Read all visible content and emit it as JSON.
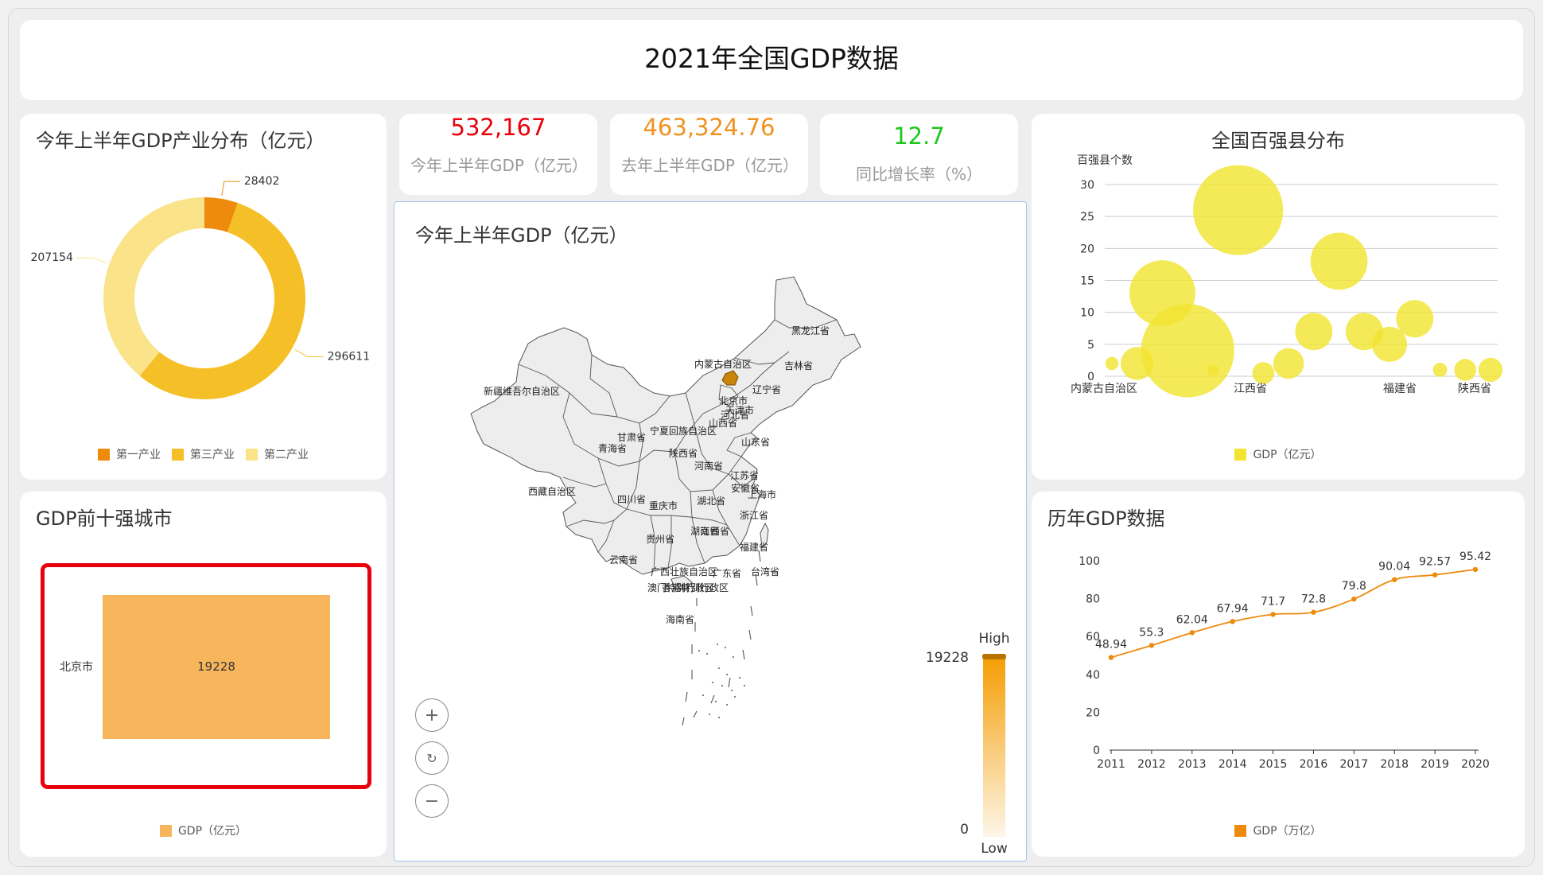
{
  "header": {
    "title": "2021年全国GDP数据"
  },
  "panels": {
    "donut_title": "今年上半年GDP产业分布（亿元）",
    "top10_title": "GDP前十强城市",
    "map_title": "今年上半年GDP（亿元）",
    "bubble_title": "全国百强县分布",
    "line_title": "历年GDP数据"
  },
  "kpis": [
    {
      "value": "532,167",
      "label": "今年上半年GDP（亿元）",
      "color": "#e8000b"
    },
    {
      "value": "463,324.76",
      "label": "去年上半年GDP（亿元）",
      "color": "#f0921e"
    },
    {
      "value": "12.7",
      "label": "同比增长率（%）",
      "color": "#1ec71e"
    }
  ],
  "map": {
    "visual_map": {
      "high_text": "High",
      "low_text": "Low",
      "max": "19228",
      "min": "0"
    },
    "province_labels": [
      "黑龙江省",
      "吉林省",
      "辽宁省",
      "内蒙古自治区",
      "新疆维吾尔自治区",
      "北京市",
      "天津市",
      "河北省",
      "山西省",
      "山东省",
      "宁夏回族自治区",
      "甘肃省",
      "青海省",
      "陕西省",
      "河南省",
      "江苏省",
      "安徽省",
      "上海市",
      "西藏自治区",
      "四川省",
      "湖北省",
      "重庆市",
      "浙江省",
      "江西省",
      "湖南省",
      "贵州省",
      "福建省",
      "云南省",
      "广西壮族自治区",
      "广东省",
      "台湾省",
      "香港特别行政区",
      "澳门特别行政区",
      "海南省"
    ],
    "zoom_in_icon": "plus-icon",
    "reset_icon": "refresh-icon",
    "zoom_out_icon": "minus-icon"
  },
  "chart_data": [
    {
      "type": "pie",
      "variant": "donut",
      "title": "今年上半年GDP产业分布（亿元）",
      "slices": [
        {
          "name": "第一产业",
          "value": 28402,
          "color": "#ee8a0c"
        },
        {
          "name": "第三产业",
          "value": 296611,
          "color": "#f5c027"
        },
        {
          "name": "第二产业",
          "value": 207154,
          "color": "#fae388"
        }
      ],
      "legend_position": "bottom"
    },
    {
      "type": "treemap",
      "title": "GDP前十强城市",
      "items": [
        {
          "name": "北京市",
          "value": 19228
        }
      ],
      "color": "#f7b55c",
      "legend": [
        "GDP（亿元）"
      ],
      "legend_position": "bottom"
    },
    {
      "type": "map",
      "title": "今年上半年GDP（亿元）",
      "regions": [
        {
          "name": "北京市",
          "value": 19228
        }
      ],
      "range": [
        0,
        19228
      ]
    },
    {
      "type": "scatter",
      "variant": "bubble",
      "title": "全国百强县分布",
      "ylabel": "百强县个数",
      "ylim": [
        0,
        30
      ],
      "yticks": [
        0,
        5,
        10,
        15,
        20,
        25,
        30
      ],
      "x_tick_labels": [
        "内蒙古自治区",
        "江西省",
        "福建省",
        "陕西省"
      ],
      "points": [
        {
          "x": 0.0,
          "y": 2,
          "size": 12
        },
        {
          "x": 1.0,
          "y": 2,
          "size": 30
        },
        {
          "x": 2.0,
          "y": 13,
          "size": 60
        },
        {
          "x": 3.0,
          "y": 4,
          "size": 85
        },
        {
          "x": 4.0,
          "y": 1,
          "size": 10
        },
        {
          "x": 5.0,
          "y": 26,
          "size": 82
        },
        {
          "x": 6.0,
          "y": 0.5,
          "size": 20
        },
        {
          "x": 7.0,
          "y": 2,
          "size": 28
        },
        {
          "x": 8.0,
          "y": 7,
          "size": 34
        },
        {
          "x": 9.0,
          "y": 18,
          "size": 52
        },
        {
          "x": 10.0,
          "y": 7,
          "size": 34
        },
        {
          "x": 11.0,
          "y": 5,
          "size": 32
        },
        {
          "x": 12.0,
          "y": 9,
          "size": 34
        },
        {
          "x": 13.0,
          "y": 1,
          "size": 13
        },
        {
          "x": 14.0,
          "y": 1,
          "size": 20
        },
        {
          "x": 15.0,
          "y": 1,
          "size": 22
        }
      ],
      "color": "#f2e431",
      "legend": [
        "GDP（亿元）"
      ],
      "legend_position": "bottom",
      "grid": true
    },
    {
      "type": "line",
      "title": "历年GDP数据",
      "x": [
        "2011",
        "2012",
        "2013",
        "2014",
        "2015",
        "2016",
        "2017",
        "2018",
        "2019",
        "2020"
      ],
      "series": [
        {
          "name": "GDP（万亿）",
          "values": [
            48.94,
            55.3,
            62.04,
            67.94,
            71.7,
            72.8,
            79.8,
            90.04,
            92.57,
            95.42
          ],
          "color": "#ee8a0c"
        }
      ],
      "ylim": [
        0,
        100
      ],
      "yticks": [
        0,
        20,
        40,
        60,
        80,
        100
      ],
      "legend_position": "bottom",
      "smooth": true
    }
  ]
}
